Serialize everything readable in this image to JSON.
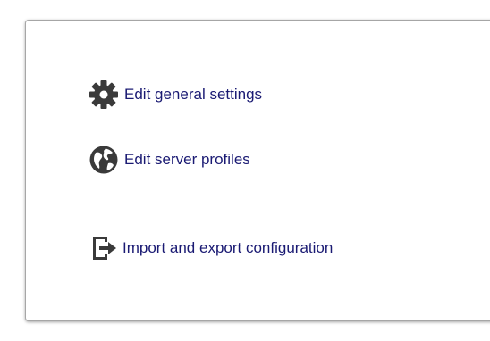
{
  "menu": {
    "general_settings_label": "Edit general settings",
    "server_profiles_label": "Edit server profiles",
    "import_export_label": "Import and export configuration"
  },
  "icons": {
    "general_settings": "gear-icon",
    "server_profiles": "globe-icon",
    "import_export": "exit-arrow-icon"
  },
  "colors": {
    "link_text": "#1a1a73",
    "icon": "#3a3a3a"
  }
}
